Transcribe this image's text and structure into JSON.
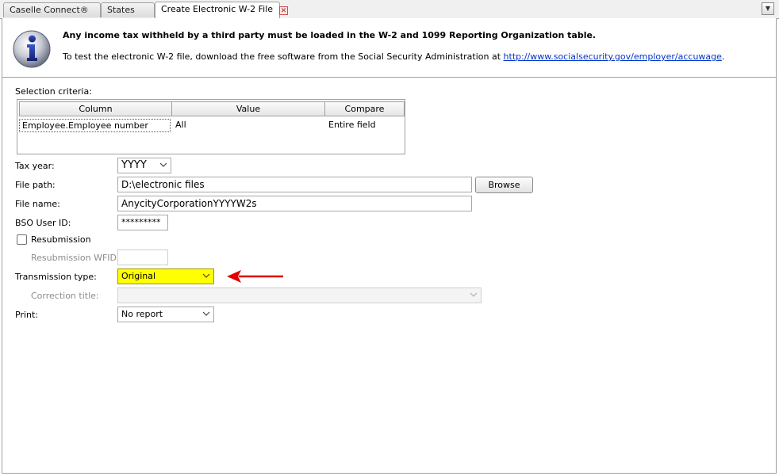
{
  "tabs": [
    {
      "label": "Caselle Connect®"
    },
    {
      "label": "States"
    },
    {
      "label": "Create Electronic W-2 File",
      "close_glyph": "✕"
    }
  ],
  "info": {
    "icon": "info-icon",
    "bold_text": "Any income tax withheld by a third party must be loaded in the W-2 and 1099 Reporting Organization table.",
    "line_prefix": "To test the electronic W-2 file, download the free software from the Social Security Administration at ",
    "link": "http://www.socialsecurity.gov/employer/accuwage",
    "line_suffix": "."
  },
  "selection": {
    "label": "Selection criteria:",
    "columns": [
      "Column",
      "Value",
      "Compare"
    ],
    "rows": [
      {
        "column": "Employee.Employee number",
        "value": "All",
        "compare": "Entire field"
      }
    ]
  },
  "form": {
    "tax_year": {
      "label": "Tax year:",
      "value": "YYYY"
    },
    "file_path": {
      "label": "File path:",
      "value": "D:\\electronic files",
      "browse": "Browse"
    },
    "file_name": {
      "label": "File name:",
      "value": "AnycityCorporationYYYYW2s"
    },
    "bso_user_id": {
      "label": "BSO User ID:",
      "value": "*********"
    },
    "resubmission": {
      "label": "Resubmission",
      "checked": false
    },
    "resubmission_wfid": {
      "label": "Resubmission WFID:",
      "value": ""
    },
    "transmission_type": {
      "label": "Transmission type:",
      "value": "Original"
    },
    "correction_title": {
      "label": "Correction title:",
      "value": ""
    },
    "print": {
      "label": "Print:",
      "value": "No report"
    }
  },
  "colors": {
    "highlight": "#ffff00",
    "arrow": "#e00000",
    "link": "#0033cc"
  }
}
